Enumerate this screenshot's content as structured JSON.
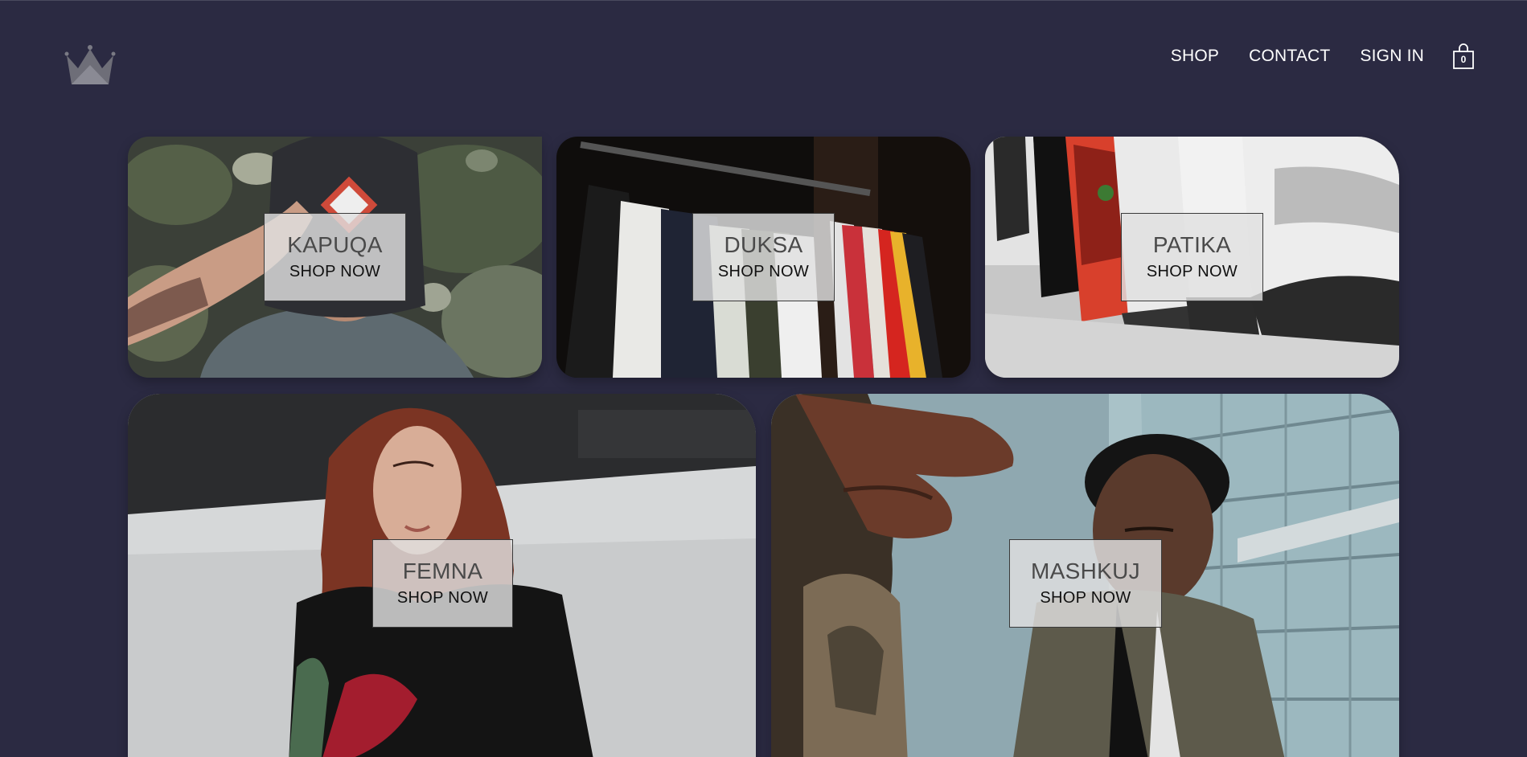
{
  "header": {
    "logo_icon": "crown-icon",
    "nav": [
      {
        "label": "SHOP"
      },
      {
        "label": "CONTACT"
      },
      {
        "label": "SIGN IN"
      }
    ],
    "cart": {
      "icon": "shopping-bag-icon",
      "count": "0"
    }
  },
  "directory": {
    "items": [
      {
        "title": "KAPUQA",
        "subtitle": "SHOP NOW"
      },
      {
        "title": "DUKSA",
        "subtitle": "SHOP NOW"
      },
      {
        "title": "PATIKA",
        "subtitle": "SHOP NOW"
      },
      {
        "title": "FEMNA",
        "subtitle": "SHOP NOW"
      },
      {
        "title": "MASHKUJ",
        "subtitle": "SHOP NOW"
      }
    ]
  },
  "colors": {
    "background": "#2b2a42",
    "nav_text": "#ffffff",
    "label_box": "#e1e1e1"
  }
}
